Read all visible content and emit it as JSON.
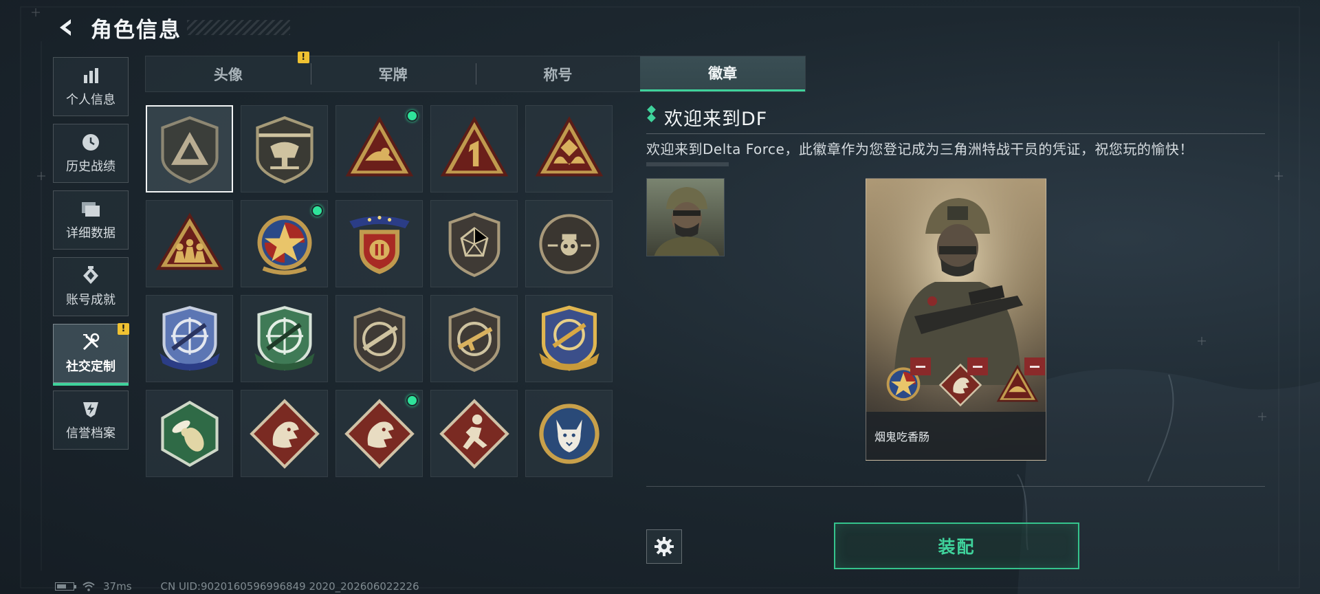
{
  "header": {
    "title": "角色信息"
  },
  "sidebar": {
    "items": [
      {
        "label": "个人信息",
        "icon": "bar-chart-icon",
        "active": false,
        "warning": ""
      },
      {
        "label": "历史战绩",
        "icon": "clock-icon",
        "active": false,
        "warning": ""
      },
      {
        "label": "详细数据",
        "icon": "folder-icon",
        "active": false,
        "warning": ""
      },
      {
        "label": "账号成就",
        "icon": "achievement-icon",
        "active": false,
        "warning": ""
      },
      {
        "label": "社交定制",
        "icon": "tools-icon",
        "active": true,
        "warning": "!"
      },
      {
        "label": "信誉档案",
        "icon": "credit-icon",
        "active": false,
        "warning": ""
      }
    ]
  },
  "tabs": [
    {
      "label": "头像",
      "warning": "!"
    },
    {
      "label": "军牌",
      "warning": ""
    },
    {
      "label": "称号",
      "warning": ""
    },
    {
      "label": "徽章",
      "warning": "",
      "active": true
    }
  ],
  "badges": [
    {
      "name": "delta-triangle-badge",
      "new": false,
      "selected": true
    },
    {
      "name": "helicopter-badge",
      "new": false
    },
    {
      "name": "helmet-triangle-badge",
      "new": true
    },
    {
      "name": "number-one-badge",
      "new": false
    },
    {
      "name": "hands-triangle-badge",
      "new": false
    },
    {
      "name": "squad-triangle-badge",
      "new": false
    },
    {
      "name": "star-emblem-badge",
      "new": true
    },
    {
      "name": "ribbon-shield-badge",
      "new": false
    },
    {
      "name": "geometric-shield-badge",
      "new": false
    },
    {
      "name": "skull-round-badge",
      "new": false
    },
    {
      "name": "blue-sniper-badge",
      "new": false
    },
    {
      "name": "green-sniper-badge",
      "new": false
    },
    {
      "name": "shotgun-badge",
      "new": false
    },
    {
      "name": "rifle-badge",
      "new": false
    },
    {
      "name": "gold-sniper-badge",
      "new": false
    },
    {
      "name": "wasp-hex-badge",
      "new": false
    },
    {
      "name": "dragon-diamond-badge",
      "new": false
    },
    {
      "name": "dragon-diamond-badge-2",
      "new": true
    },
    {
      "name": "runner-diamond-badge",
      "new": false
    },
    {
      "name": "lynx-round-badge",
      "new": false
    }
  ],
  "detail": {
    "title": "欢迎来到DF",
    "description": "欢迎来到Delta Force，此徽章作为您登记成为三角洲特战干员的凭证，祝您玩的愉快！"
  },
  "card": {
    "player_name": "烟鬼吃香肠"
  },
  "actions": {
    "equip_label": "装配"
  },
  "status_bar": {
    "ping": "37ms",
    "uid": "CN UID:9020160596996849 2020_202606022226"
  },
  "colors": {
    "accent": "#3fd29b",
    "warning": "#f0c232",
    "remove": "#8a2a2a"
  }
}
